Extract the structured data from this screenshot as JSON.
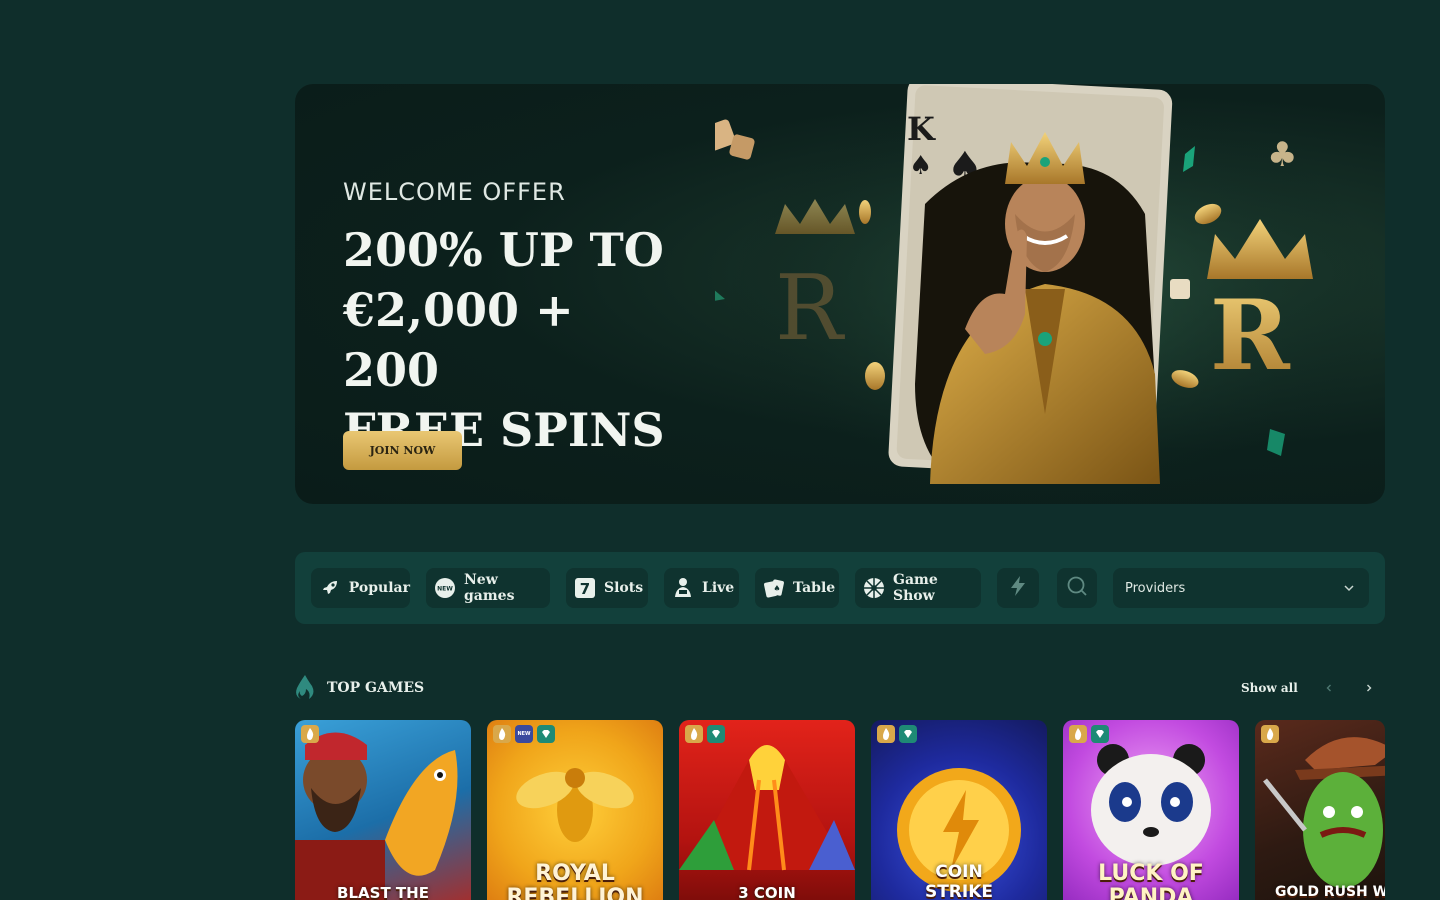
{
  "hero": {
    "eyebrow": "WELCOME OFFER",
    "title_lines": [
      "200% UP TO",
      "€2,000 + 200",
      "FREE SPINS"
    ],
    "cta": "JOIN NOW"
  },
  "categories": {
    "items": [
      {
        "label": "Popular",
        "icon": "rocket-icon"
      },
      {
        "label": "New games",
        "icon": "new-badge-icon"
      },
      {
        "label": "Slots",
        "icon": "seven-slot-icon"
      },
      {
        "label": "Live",
        "icon": "dealer-icon"
      },
      {
        "label": "Table",
        "icon": "cards-icon"
      },
      {
        "label": "Game Show",
        "icon": "wheel-icon"
      }
    ],
    "lightning_icon": "lightning-icon",
    "search_icon": "search-icon",
    "providers_label": "Providers"
  },
  "top_games": {
    "title": "TOP GAMES",
    "show_all": "Show all",
    "cards": [
      {
        "label": "BLAST THE",
        "badges": [
          "hot"
        ]
      },
      {
        "label": "ROYAL REBELLION",
        "badges": [
          "hot",
          "new",
          "dia"
        ]
      },
      {
        "label": "3 COIN",
        "badges": [
          "hot",
          "dia"
        ]
      },
      {
        "label": "COIN STRIKE HOLD AND",
        "badges": [
          "hot",
          "dia"
        ]
      },
      {
        "label": "LUCK OF PANDA",
        "badges": [
          "hot",
          "dia"
        ]
      },
      {
        "label": "GOLD RUSH WI",
        "badges": [
          "hot"
        ]
      }
    ]
  },
  "colors": {
    "background": "#0f2e2b",
    "accent_gold": "#d9a84a",
    "bar": "#12403b"
  }
}
